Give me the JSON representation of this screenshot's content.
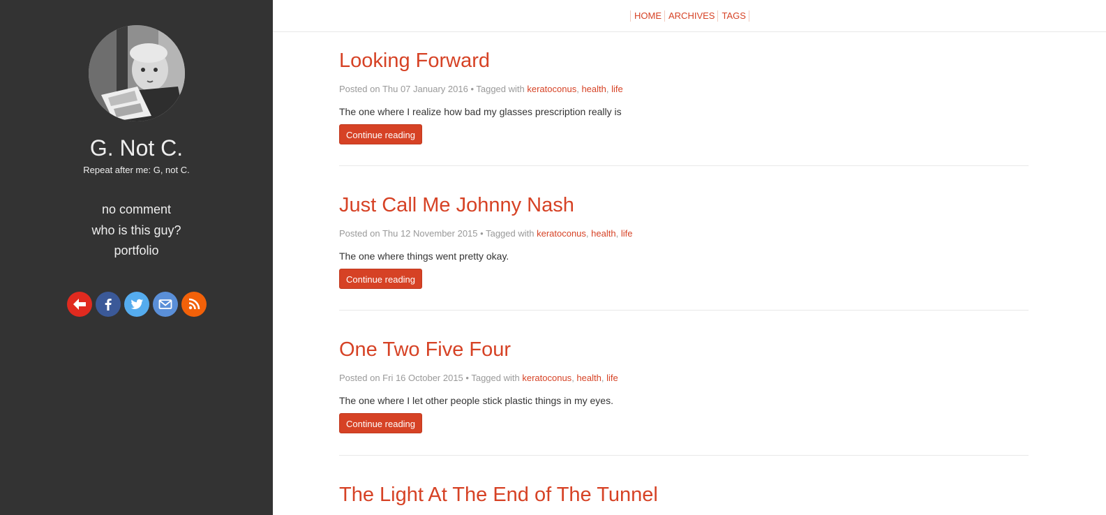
{
  "sidebar": {
    "site_name": "G. Not C.",
    "tagline": "Repeat after me: G, not C.",
    "links": [
      "no comment",
      "who is this guy?",
      "portfolio"
    ],
    "social": [
      {
        "icon": "back-arrow-icon",
        "color": "#e02a1f"
      },
      {
        "icon": "facebook-icon",
        "color": "#3b5998"
      },
      {
        "icon": "twitter-icon",
        "color": "#55acee"
      },
      {
        "icon": "envelope-icon",
        "color": "#5a8fd8"
      },
      {
        "icon": "rss-icon",
        "color": "#f26109"
      }
    ]
  },
  "nav": {
    "home": "HOME",
    "archives": "ARCHIVES",
    "tags": "TAGS"
  },
  "posts": [
    {
      "title": "Looking Forward",
      "posted_prefix": "Posted on",
      "date": "Thu 07 January 2016",
      "tagged_prefix": "• Tagged with",
      "tags": [
        "keratoconus",
        "health",
        "life"
      ],
      "summary": "The one where I realize how bad my glasses prescription really is",
      "button": "Continue reading"
    },
    {
      "title": "Just Call Me Johnny Nash",
      "posted_prefix": "Posted on",
      "date": "Thu 12 November 2015",
      "tagged_prefix": "• Tagged with",
      "tags": [
        "keratoconus",
        "health",
        "life"
      ],
      "summary": "The one where things went pretty okay.",
      "button": "Continue reading"
    },
    {
      "title": "One Two Five Four",
      "posted_prefix": "Posted on",
      "date": "Fri 16 October 2015",
      "tagged_prefix": "• Tagged with",
      "tags": [
        "keratoconus",
        "health",
        "life"
      ],
      "summary": "The one where I let other people stick plastic things in my eyes.",
      "button": "Continue reading"
    },
    {
      "title": "The Light At The End of The Tunnel"
    }
  ],
  "colors": {
    "accent": "#d64225",
    "sidebar_bg": "#333333"
  }
}
